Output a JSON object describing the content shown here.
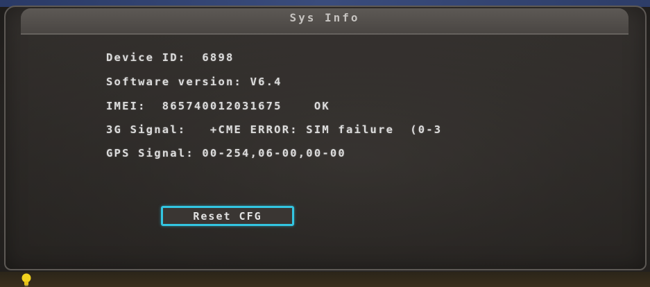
{
  "window": {
    "title": "Sys Info"
  },
  "info": {
    "device_id": "Device ID:  6898",
    "software_version": "Software version: V6.4",
    "imei": "IMEI:  865740012031675    OK",
    "signal_3g": "3G Signal:   +CME ERROR: SIM failure  (0-3",
    "gps_signal": "GPS Signal: 00-254,06-00,00-00"
  },
  "actions": {
    "reset_label": "Reset CFG"
  },
  "colors": {
    "panel_background": "#2c2927",
    "text": "#dcdcdc",
    "button_border": "#33c6e2",
    "indicator": "#f2d21e"
  },
  "icons": {
    "status_indicator": "lightbulb-icon"
  }
}
